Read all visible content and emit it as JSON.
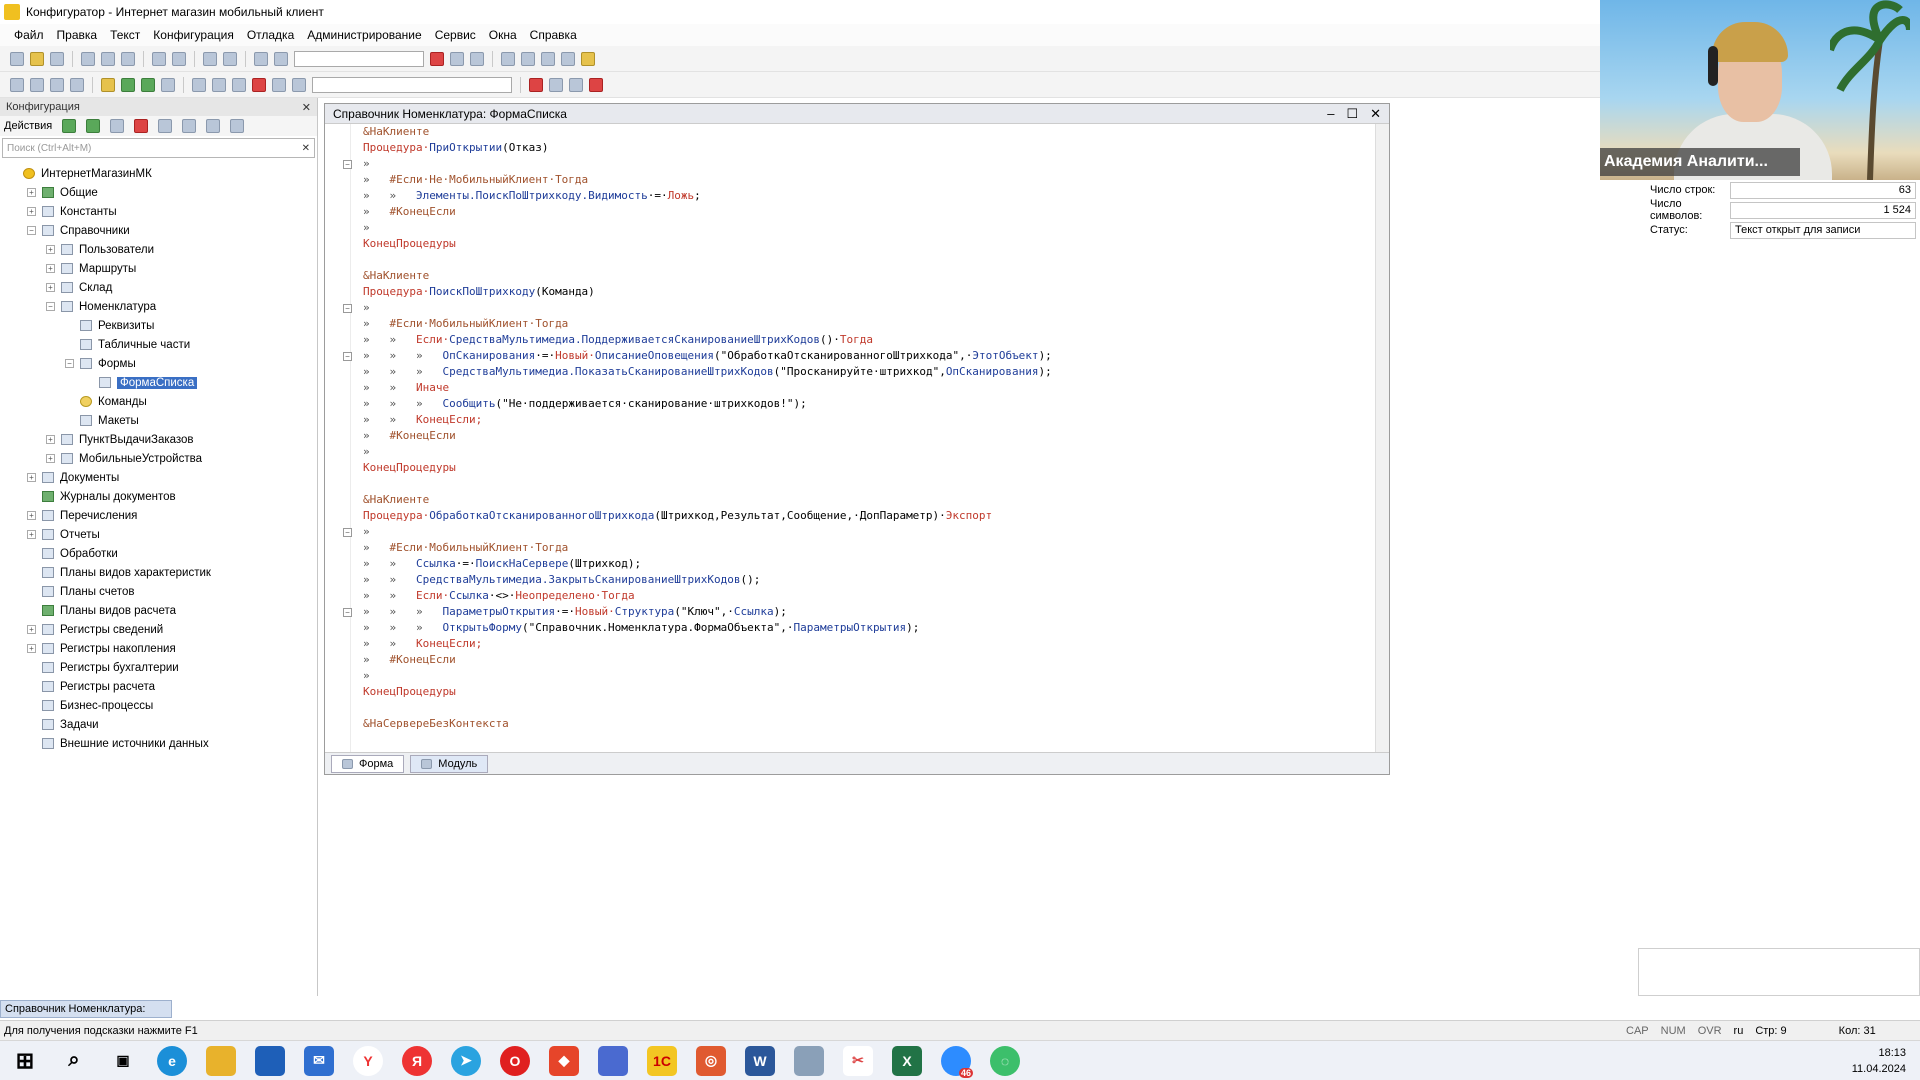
{
  "window": {
    "title": "Конфигуратор - Интернет магазин мобильный клиент"
  },
  "menu": [
    "Файл",
    "Правка",
    "Текст",
    "Конфигурация",
    "Отладка",
    "Администрирование",
    "Сервис",
    "Окна",
    "Справка"
  ],
  "left_panel": {
    "title": "Конфигурация",
    "actions_label": "Действия",
    "search_placeholder": "Поиск (Ctrl+Alt+M)",
    "footer_tab": "Справочник Номенклатура:",
    "tree": [
      {
        "label": "ИнтернетМагазинМК",
        "level": 0,
        "toggle": "",
        "icon": "root"
      },
      {
        "label": "Общие",
        "level": 1,
        "toggle": "+",
        "icon": "grn"
      },
      {
        "label": "Константы",
        "level": 1,
        "toggle": "+",
        "icon": "tbl"
      },
      {
        "label": "Справочники",
        "level": 1,
        "toggle": "-",
        "icon": "tbl"
      },
      {
        "label": "Пользователи",
        "level": 2,
        "toggle": "+",
        "icon": "tbl"
      },
      {
        "label": "Маршруты",
        "level": 2,
        "toggle": "+",
        "icon": "tbl"
      },
      {
        "label": "Склад",
        "level": 2,
        "toggle": "+",
        "icon": "tbl"
      },
      {
        "label": "Номенклатура",
        "level": 2,
        "toggle": "-",
        "icon": "tbl"
      },
      {
        "label": "Реквизиты",
        "level": 3,
        "toggle": "",
        "icon": "tbl"
      },
      {
        "label": "Табличные части",
        "level": 3,
        "toggle": "",
        "icon": "tbl"
      },
      {
        "label": "Формы",
        "level": 3,
        "toggle": "-",
        "icon": "tbl"
      },
      {
        "label": "ФормаСписка",
        "level": 4,
        "toggle": "",
        "icon": "tbl",
        "selected": true
      },
      {
        "label": "Команды",
        "level": 3,
        "toggle": "",
        "icon": "yel"
      },
      {
        "label": "Макеты",
        "level": 3,
        "toggle": "",
        "icon": "tbl"
      },
      {
        "label": "ПунктВыдачиЗаказов",
        "level": 2,
        "toggle": "+",
        "icon": "tbl"
      },
      {
        "label": "МобильныеУстройства",
        "level": 2,
        "toggle": "+",
        "icon": "tbl"
      },
      {
        "label": "Документы",
        "level": 1,
        "toggle": "+",
        "icon": "tbl"
      },
      {
        "label": "Журналы документов",
        "level": 1,
        "toggle": "",
        "icon": "grn"
      },
      {
        "label": "Перечисления",
        "level": 1,
        "toggle": "+",
        "icon": "tbl"
      },
      {
        "label": "Отчеты",
        "level": 1,
        "toggle": "+",
        "icon": "tbl"
      },
      {
        "label": "Обработки",
        "level": 1,
        "toggle": "",
        "icon": "tbl"
      },
      {
        "label": "Планы видов характеристик",
        "level": 1,
        "toggle": "",
        "icon": "tbl"
      },
      {
        "label": "Планы счетов",
        "level": 1,
        "toggle": "",
        "icon": "tbl"
      },
      {
        "label": "Планы видов расчета",
        "level": 1,
        "toggle": "",
        "icon": "grn"
      },
      {
        "label": "Регистры сведений",
        "level": 1,
        "toggle": "+",
        "icon": "tbl"
      },
      {
        "label": "Регистры накопления",
        "level": 1,
        "toggle": "+",
        "icon": "tbl"
      },
      {
        "label": "Регистры бухгалтерии",
        "level": 1,
        "toggle": "",
        "icon": "tbl"
      },
      {
        "label": "Регистры расчета",
        "level": 1,
        "toggle": "",
        "icon": "tbl"
      },
      {
        "label": "Бизнес-процессы",
        "level": 1,
        "toggle": "",
        "icon": "tbl"
      },
      {
        "label": "Задачи",
        "level": 1,
        "toggle": "",
        "icon": "tbl"
      },
      {
        "label": "Внешние источники данных",
        "level": 1,
        "toggle": "",
        "icon": "tbl"
      }
    ]
  },
  "editor": {
    "title": "Справочник Номенклатура: ФормаСписка",
    "tabs": [
      "Форма",
      "Модуль"
    ],
    "lines": [
      [
        [
          "dir",
          "&НаКлиенте"
        ]
      ],
      [
        [
          "kw",
          "Процедура·"
        ],
        [
          "id",
          "ПриОткрытии"
        ],
        [
          "c",
          "(Отказ)"
        ]
      ],
      [
        [
          "t",
          "»"
        ]
      ],
      [
        [
          "t",
          "»   "
        ],
        [
          "dir",
          "#Если·Не·МобильныйКлиент·Тогда"
        ]
      ],
      [
        [
          "t",
          "»   »   "
        ],
        [
          "id",
          "Элементы.ПоискПоШтрихкоду.Видимость"
        ],
        [
          "c",
          "·=·"
        ],
        [
          "kw",
          "Ложь"
        ],
        [
          "c",
          ";"
        ]
      ],
      [
        [
          "t",
          "»   "
        ],
        [
          "dir",
          "#КонецЕсли"
        ]
      ],
      [
        [
          "t",
          "»"
        ]
      ],
      [
        [
          "kw",
          "КонецПроцедуры"
        ]
      ],
      [
        [
          "c",
          ""
        ]
      ],
      [
        [
          "dir",
          "&НаКлиенте"
        ]
      ],
      [
        [
          "kw",
          "Процедура·"
        ],
        [
          "id",
          "ПоискПоШтрихкоду"
        ],
        [
          "c",
          "(Команда)"
        ]
      ],
      [
        [
          "t",
          "»"
        ]
      ],
      [
        [
          "t",
          "»   "
        ],
        [
          "dir",
          "#Если·МобильныйКлиент·Тогда"
        ]
      ],
      [
        [
          "t",
          "»   »   "
        ],
        [
          "kw",
          "Если·"
        ],
        [
          "id",
          "СредстваМультимедиа.ПоддерживаетсяСканированиеШтрихКодов"
        ],
        [
          "c",
          "()·"
        ],
        [
          "kw",
          "Тогда"
        ]
      ],
      [
        [
          "t",
          "»   »   »   "
        ],
        [
          "id",
          "ОпСканирования"
        ],
        [
          "c",
          "·=·"
        ],
        [
          "kw",
          "Новый·"
        ],
        [
          "id",
          "ОписаниеОповещения"
        ],
        [
          "str",
          "(\"ОбработкаОтсканированногоШтрихкода\",·"
        ],
        [
          "id",
          "ЭтотОбъект"
        ],
        [
          "c",
          ");"
        ]
      ],
      [
        [
          "t",
          "»   »   »   "
        ],
        [
          "id",
          "СредстваМультимедиа.ПоказатьСканированиеШтрихКодов"
        ],
        [
          "str",
          "(\"Просканируйте·штрихкод\","
        ],
        [
          "id",
          "ОпСканирования"
        ],
        [
          "c",
          ");"
        ]
      ],
      [
        [
          "t",
          "»   »   "
        ],
        [
          "kw",
          "Иначе"
        ]
      ],
      [
        [
          "t",
          "»   »   »   "
        ],
        [
          "id",
          "Сообщить"
        ],
        [
          "str",
          "(\"Не·поддерживается·сканирование·штрихкодов!\");"
        ]
      ],
      [
        [
          "t",
          "»   »   "
        ],
        [
          "kw",
          "КонецЕсли;"
        ]
      ],
      [
        [
          "t",
          "»   "
        ],
        [
          "dir",
          "#КонецЕсли"
        ]
      ],
      [
        [
          "t",
          "»"
        ]
      ],
      [
        [
          "kw",
          "КонецПроцедуры"
        ]
      ],
      [
        [
          "c",
          ""
        ]
      ],
      [
        [
          "dir",
          "&НаКлиенте"
        ]
      ],
      [
        [
          "kw",
          "Процедура·"
        ],
        [
          "id",
          "ОбработкаОтсканированногоШтрихкода"
        ],
        [
          "c",
          "(Штрихкод,Результат,Сообщение,·ДопПараметр)·"
        ],
        [
          "kw",
          "Экспорт"
        ]
      ],
      [
        [
          "t",
          "»"
        ]
      ],
      [
        [
          "t",
          "»   "
        ],
        [
          "dir",
          "#Если·МобильныйКлиент·Тогда"
        ]
      ],
      [
        [
          "t",
          "»   »   "
        ],
        [
          "id",
          "Ссылка"
        ],
        [
          "c",
          "·=·"
        ],
        [
          "id",
          "ПоискНаСервере"
        ],
        [
          "c",
          "(Штрихкод);"
        ]
      ],
      [
        [
          "t",
          "»   »   "
        ],
        [
          "id",
          "СредстваМультимедиа.ЗакрытьСканированиеШтрихКодов"
        ],
        [
          "c",
          "();"
        ]
      ],
      [
        [
          "t",
          "»   »   "
        ],
        [
          "kw",
          "Если·"
        ],
        [
          "id",
          "Ссылка"
        ],
        [
          "c",
          "·<>·"
        ],
        [
          "kw",
          "Неопределено·Тогда"
        ]
      ],
      [
        [
          "t",
          "»   »   »   "
        ],
        [
          "id",
          "ПараметрыОткрытия"
        ],
        [
          "c",
          "·=·"
        ],
        [
          "kw",
          "Новый·"
        ],
        [
          "id",
          "Структура"
        ],
        [
          "str",
          "(\"Ключ\",·"
        ],
        [
          "id",
          "Ссылка"
        ],
        [
          "c",
          ");"
        ]
      ],
      [
        [
          "t",
          "»   »   »   "
        ],
        [
          "id",
          "ОткрытьФорму"
        ],
        [
          "str",
          "(\"Справочник.Номенклатура.ФормаОбъекта\",·"
        ],
        [
          "id",
          "ПараметрыОткрытия"
        ],
        [
          "c",
          ");"
        ]
      ],
      [
        [
          "t",
          "»   »   "
        ],
        [
          "kw",
          "КонецЕсли;"
        ]
      ],
      [
        [
          "t",
          "»   "
        ],
        [
          "dir",
          "#КонецЕсли"
        ]
      ],
      [
        [
          "t",
          "»"
        ]
      ],
      [
        [
          "kw",
          "КонецПроцедуры"
        ]
      ],
      [
        [
          "c",
          ""
        ]
      ],
      [
        [
          "dir",
          "&НаСервереБезКонтекста"
        ]
      ]
    ]
  },
  "properties": {
    "rows_label": "Число строк:",
    "rows_value": "63",
    "chars_label": "Число символов:",
    "chars_value": "1 524",
    "status_label": "Статус:",
    "status_value": "Текст открыт для записи"
  },
  "webcam": {
    "label": "Академия Аналити..."
  },
  "statusbar": {
    "hint": "Для получения подсказки нажмите F1",
    "cap": "CAP",
    "num": "NUM",
    "ovr": "OVR",
    "lang": "ru",
    "line": "Стр: 9",
    "col": "Кол: 31"
  },
  "taskbar": {
    "time": "18:13",
    "date": "11.04.2024",
    "zoom_badge": "46"
  }
}
